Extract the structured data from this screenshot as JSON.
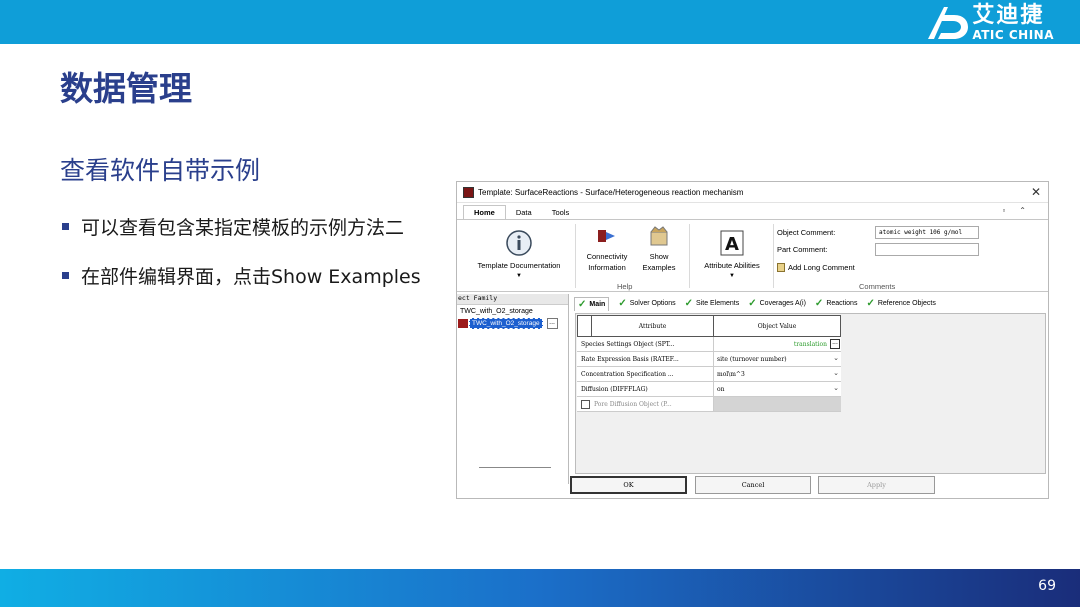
{
  "slide": {
    "title": "数据管理",
    "subtitle": "查看软件自带示例",
    "bullets": [
      "可以查看包含某指定模板的示例方法二",
      "在部件编辑界面，点击Show Examples"
    ],
    "page_number": "69",
    "logo_cn": "艾迪捷",
    "logo_en": "ATIC CHINA"
  },
  "window": {
    "title": "Template: SurfaceReactions - Surface/Heterogeneous reaction mechanism",
    "close_icon": "close-icon",
    "ribbon_tabs": [
      "Home",
      "Data",
      "Tools"
    ],
    "ribbon": {
      "template_doc": "Template Documentation",
      "connectivity_label_1": "Connectivity",
      "connectivity_label_2": "Information",
      "show_label_1": "Show",
      "show_label_2": "Examples",
      "attr_abilities": "Attribute Abilities",
      "help_group": "Help",
      "object_comment_label": "Object Comment:",
      "object_comment_value": "atomic weight 106 g/mol",
      "part_comment_label": "Part Comment:",
      "part_comment_value": "",
      "add_long_comment": "Add Long Comment",
      "comments_group": "Comments"
    },
    "left_pane": {
      "header": "ect Family",
      "item": "TWC_with_O2_storage",
      "selected": "TWC_with_O2_storage",
      "ellipsis": "..."
    },
    "tabs": [
      "Main",
      "Solver Options",
      "Site Elements",
      "Coverages A(i)",
      "Reactions",
      "Reference Objects"
    ],
    "grid": {
      "headers": [
        "Attribute",
        "Object Value"
      ],
      "rows": [
        {
          "attr": "Species Settings Object (SPT...",
          "value": "translation"
        },
        {
          "attr": "Rate Expression Basis (RATEF...",
          "value": "site (turnover number)"
        },
        {
          "attr": "Concentration Specification ...",
          "value": "mol\\m^3"
        },
        {
          "attr": "Diffusion (DIFFFLAG)",
          "value": "on"
        },
        {
          "attr": "Pore Diffusion Object (P...",
          "value": ""
        }
      ]
    },
    "buttons": {
      "ok": "OK",
      "cancel": "Cancel",
      "apply": "Apply"
    }
  }
}
